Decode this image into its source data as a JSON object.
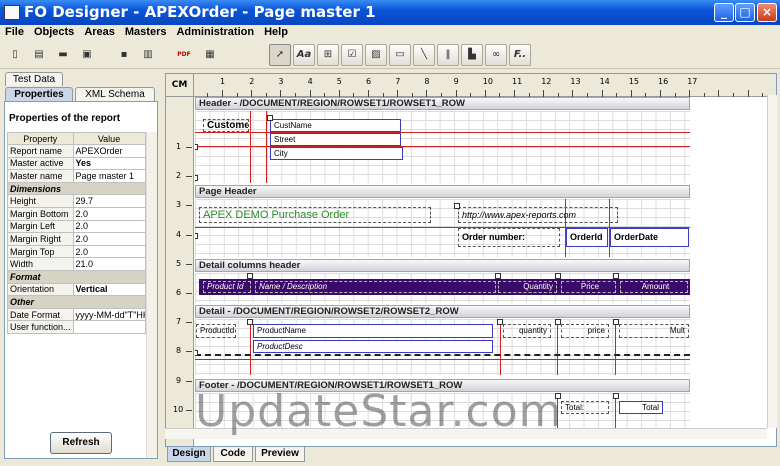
{
  "window": {
    "title": "FO Designer - APEXOrder - Page master 1"
  },
  "menu": [
    "File",
    "Objects",
    "Areas",
    "Masters",
    "Administration",
    "Help"
  ],
  "toolbar": {
    "icons": [
      "new-file-icon",
      "open-icon",
      "open-folder-icon",
      "save-icon",
      "export-icon",
      "pdf-icon",
      "preview-icon",
      "pointer-icon",
      "text-icon",
      "table-icon",
      "checkbox-icon",
      "image-icon",
      "rectangle-icon",
      "line-icon",
      "barcode-icon",
      "chart-icon",
      "link-icon",
      "function-icon"
    ],
    "pdf_label": "PDF",
    "text_label": "Aa",
    "function_label": "F.."
  },
  "left_tabs": {
    "top": "Test Data",
    "properties": "Properties",
    "schema": "XML Schema"
  },
  "properties": {
    "heading": "Properties of the report",
    "col_property": "Property",
    "col_value": "Value",
    "rows": [
      {
        "k": "Report name",
        "v": "APEXOrder"
      },
      {
        "k": "Master active",
        "v": "Yes"
      },
      {
        "k": "Master name",
        "v": "Page master 1"
      },
      {
        "cat": "Dimensions"
      },
      {
        "k": "Height",
        "v": "29.7"
      },
      {
        "k": "Margin Bottom",
        "v": "2.0"
      },
      {
        "k": "Margin Left",
        "v": "2.0"
      },
      {
        "k": "Margin Right",
        "v": "2.0"
      },
      {
        "k": "Margin Top",
        "v": "2.0"
      },
      {
        "k": "Width",
        "v": "21.0"
      },
      {
        "cat": "Format"
      },
      {
        "k": "Orientation",
        "v": "Vertical"
      },
      {
        "cat": "Other"
      },
      {
        "k": "Date Format",
        "v": "yyyy-MM-dd\"T\"HH"
      },
      {
        "k": "User function...",
        "v": ""
      }
    ],
    "refresh": "Refresh"
  },
  "ruler": {
    "unit": "CM",
    "h": [
      "1",
      "2",
      "3",
      "4",
      "5",
      "6",
      "7",
      "8",
      "9",
      "10",
      "11",
      "12",
      "13",
      "14",
      "15",
      "16",
      "17"
    ],
    "v": [
      "1",
      "2",
      "3",
      "4",
      "5",
      "6",
      "7",
      "8",
      "9",
      "10"
    ]
  },
  "bands": {
    "header": {
      "title": "Header - /DOCUMENT/REGION/ROWSET1/ROWSET1_ROW",
      "customer": "Customer",
      "custname": "CustName",
      "street": "Street",
      "city": "City"
    },
    "page_header": {
      "title": "Page Header",
      "demo": "APEX DEMO Purchase Order",
      "url": "http://www.apex-reports.com",
      "order_number": "Order number:",
      "order_id": "OrderId",
      "order_date": "OrderDate"
    },
    "detail_columns": {
      "title": "Detail columns header",
      "product_id": "Product Id",
      "name_desc": "Name / Description",
      "quantity": "Quantity",
      "price": "Price",
      "amount": "Amount"
    },
    "detail": {
      "title": "Detail - /DOCUMENT/REGION/ROWSET2/ROWSET2_ROW",
      "productid": "ProductId",
      "productname": "ProductName",
      "quantity": "quantity",
      "price": "price",
      "mult": "Mult",
      "productdesc": "ProductDesc"
    },
    "footer": {
      "title": "Footer - /DOCUMENT/REGION/ROWSET1/ROWSET1_ROW",
      "total_label": "Total:",
      "total": "Total"
    }
  },
  "bottom_tabs": [
    "Design",
    "Code",
    "Preview"
  ],
  "watermark": "UpdateStar.com",
  "colors": {
    "title_blue": "#0a55d8",
    "detail_col_bg": "#3a0a6a",
    "guide_red": "#d02020",
    "field_blue": "#3a3ac8",
    "demo_green": "#2a8a2a"
  }
}
